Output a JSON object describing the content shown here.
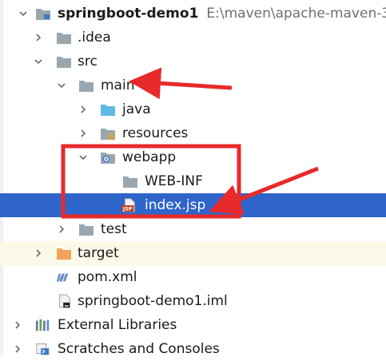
{
  "project_tree": {
    "root": {
      "name": "springboot-demo1",
      "path": "E:\\maven\\apache-maven-3"
    },
    "items": {
      "idea": ".idea",
      "src": "src",
      "main": "main",
      "java": "java",
      "resources": "resources",
      "webapp": "webapp",
      "webinf": "WEB-INF",
      "indexjsp": "index.jsp",
      "test": "test",
      "target": "target",
      "pom": "pom.xml",
      "iml": "springboot-demo1.iml",
      "external_libraries": "External Libraries",
      "scratches": "Scratches and Consoles"
    },
    "icon_labels": {
      "jsp_badge": "JSP"
    }
  },
  "colors": {
    "selection": "#2f65ca",
    "annotation_red": "#e82a2a",
    "folder_gray": "#9aa7b0",
    "folder_blue": "#5fb8e6",
    "folder_orange": "#f0a35a",
    "highlight_row": "#fcf9e8"
  }
}
